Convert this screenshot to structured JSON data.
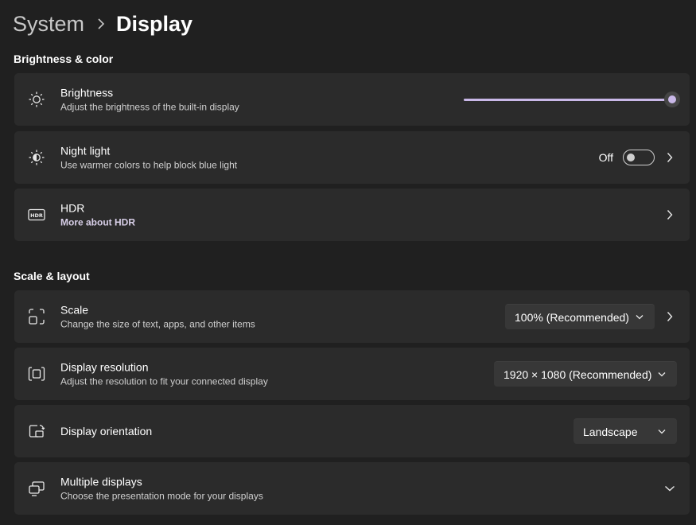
{
  "breadcrumb": {
    "parent": "System",
    "current": "Display"
  },
  "sections": {
    "brightness_color": "Brightness & color",
    "scale_layout": "Scale & layout"
  },
  "brightness": {
    "title": "Brightness",
    "subtitle": "Adjust the brightness of the built-in display",
    "icon": "sun-icon",
    "value_fraction": 1.0
  },
  "night_light": {
    "title": "Night light",
    "subtitle": "Use warmer colors to help block blue light",
    "icon": "night-light-icon",
    "toggle_label": "Off",
    "toggle_on": false
  },
  "hdr": {
    "title": "HDR",
    "subtitle": "More about HDR",
    "icon": "hdr-icon"
  },
  "scale": {
    "title": "Scale",
    "subtitle": "Change the size of text, apps, and other items",
    "icon": "scale-icon",
    "selected": "100% (Recommended)"
  },
  "resolution": {
    "title": "Display resolution",
    "subtitle": "Adjust the resolution to fit your connected display",
    "icon": "resolution-icon",
    "selected": "1920 × 1080 (Recommended)"
  },
  "orientation": {
    "title": "Display orientation",
    "icon": "orientation-icon",
    "selected": "Landscape"
  },
  "multiple_displays": {
    "title": "Multiple displays",
    "subtitle": "Choose the presentation mode for your displays",
    "icon": "multiple-displays-icon"
  },
  "colors": {
    "background": "#202020",
    "card": "#2b2b2b",
    "accent": "#c9b8e8"
  }
}
